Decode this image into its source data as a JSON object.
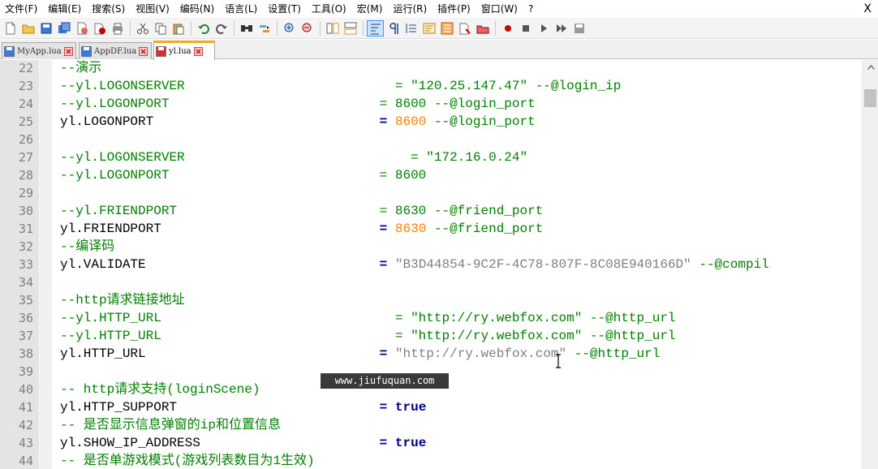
{
  "menu": [
    "文件(F)",
    "编辑(E)",
    "搜索(S)",
    "视图(V)",
    "编码(N)",
    "语言(L)",
    "设置(T)",
    "工具(O)",
    "宏(M)",
    "运行(R)",
    "插件(P)",
    "窗口(W)",
    "?"
  ],
  "menu_close": "X",
  "tabs": [
    {
      "label": "MyApp.lua",
      "active": false
    },
    {
      "label": "AppDF.lua",
      "active": false
    },
    {
      "label": "yl.lua",
      "active": true
    }
  ],
  "toolbar_icons": [
    "new-file-icon",
    "open-file-icon",
    "save-icon",
    "save-all-icon",
    "close-icon",
    "close-all-icon",
    "print-icon",
    "cut-icon",
    "copy-icon",
    "paste-icon",
    "undo-icon",
    "redo-icon",
    "find-icon",
    "replace-icon",
    "zoom-in-icon",
    "zoom-out-icon",
    "sync-vertical-icon",
    "sync-horizontal-icon",
    "word-wrap-icon",
    "show-all-chars-icon",
    "indent-guide-icon",
    "doc-map-icon",
    "function-list-icon",
    "folder-as-workspace-icon",
    "monitor-icon",
    "record-macro-icon",
    "stop-macro-icon",
    "play-macro-icon",
    "run-macro-multiple-icon",
    "save-macro-icon"
  ],
  "lines": [
    {
      "n": "22",
      "segs": [
        {
          "t": "--演示",
          "c": "cmt"
        }
      ]
    },
    {
      "n": "23",
      "segs": [
        {
          "t": "--yl.LOGONSERVER                           = \"120.25.147.47\" --@login_ip",
          "c": "cmt"
        }
      ]
    },
    {
      "n": "24",
      "segs": [
        {
          "t": "--yl.LOGONPORT                           = 8600 --@login_port",
          "c": "cmt"
        }
      ]
    },
    {
      "n": "25",
      "segs": [
        {
          "t": "yl.LOGONPORT                             ",
          "c": ""
        },
        {
          "t": "=",
          "c": "op"
        },
        {
          "t": " ",
          "c": ""
        },
        {
          "t": "8600",
          "c": "num"
        },
        {
          "t": " --@login_port",
          "c": "cmt"
        }
      ]
    },
    {
      "n": "26",
      "segs": []
    },
    {
      "n": "27",
      "segs": [
        {
          "t": "--yl.LOGONSERVER                             = \"172.16.0.24\"",
          "c": "cmt"
        }
      ]
    },
    {
      "n": "28",
      "segs": [
        {
          "t": "--yl.LOGONPORT                           = 8600",
          "c": "cmt"
        }
      ]
    },
    {
      "n": "29",
      "segs": []
    },
    {
      "n": "30",
      "segs": [
        {
          "t": "--yl.FRIENDPORT                          = 8630 --@friend_port",
          "c": "cmt"
        }
      ]
    },
    {
      "n": "31",
      "segs": [
        {
          "t": "yl.FRIENDPORT                            ",
          "c": ""
        },
        {
          "t": "=",
          "c": "op"
        },
        {
          "t": " ",
          "c": ""
        },
        {
          "t": "8630",
          "c": "num"
        },
        {
          "t": " --@friend_port",
          "c": "cmt"
        }
      ]
    },
    {
      "n": "32",
      "segs": [
        {
          "t": "--编译码",
          "c": "cmt"
        }
      ]
    },
    {
      "n": "33",
      "segs": [
        {
          "t": "yl.VALIDATE                              ",
          "c": ""
        },
        {
          "t": "=",
          "c": "op"
        },
        {
          "t": " ",
          "c": ""
        },
        {
          "t": "\"B3D44854-9C2F-4C78-807F-8C08E940166D\"",
          "c": "str"
        },
        {
          "t": " --@compil",
          "c": "cmt"
        }
      ]
    },
    {
      "n": "34",
      "segs": []
    },
    {
      "n": "35",
      "segs": [
        {
          "t": "--http请求链接地址",
          "c": "cmt"
        }
      ]
    },
    {
      "n": "36",
      "segs": [
        {
          "t": "--yl.HTTP_URL                              = \"http://ry.webfox.com\" --@http_url",
          "c": "cmt"
        }
      ]
    },
    {
      "n": "37",
      "segs": [
        {
          "t": "--yl.HTTP_URL                              = \"http://ry.webfox.com\" --@http_url",
          "c": "cmt"
        }
      ]
    },
    {
      "n": "38",
      "segs": [
        {
          "t": "yl.HTTP_URL                              ",
          "c": ""
        },
        {
          "t": "=",
          "c": "op"
        },
        {
          "t": " ",
          "c": ""
        },
        {
          "t": "\"http://ry.webfox.com\"",
          "c": "str"
        },
        {
          "t": " --@http_url",
          "c": "cmt"
        }
      ]
    },
    {
      "n": "39",
      "segs": []
    },
    {
      "n": "40",
      "segs": [
        {
          "t": "-- http请求支持(loginScene)",
          "c": "cmt"
        }
      ]
    },
    {
      "n": "41",
      "segs": [
        {
          "t": "yl.HTTP_SUPPORT                          ",
          "c": ""
        },
        {
          "t": "=",
          "c": "op"
        },
        {
          "t": " ",
          "c": ""
        },
        {
          "t": "true",
          "c": "kw"
        }
      ]
    },
    {
      "n": "42",
      "segs": [
        {
          "t": "-- 是否显示信息弹窗的ip和位置信息",
          "c": "cmt"
        }
      ]
    },
    {
      "n": "43",
      "segs": [
        {
          "t": "yl.SHOW_IP_ADDRESS                       ",
          "c": ""
        },
        {
          "t": "=",
          "c": "op"
        },
        {
          "t": " ",
          "c": ""
        },
        {
          "t": "true",
          "c": "kw"
        }
      ]
    },
    {
      "n": "44",
      "segs": [
        {
          "t": "-- 是否单游戏模式(游戏列表数目为1生效)",
          "c": "cmt"
        }
      ]
    }
  ],
  "watermark": "www.jiufuquan.com",
  "colors": {
    "comment": "#008000",
    "number": "#ff8000",
    "string": "#808080",
    "operator": "#000080",
    "keyword": "#00008b",
    "active_tab_accent": "#f5a623"
  }
}
